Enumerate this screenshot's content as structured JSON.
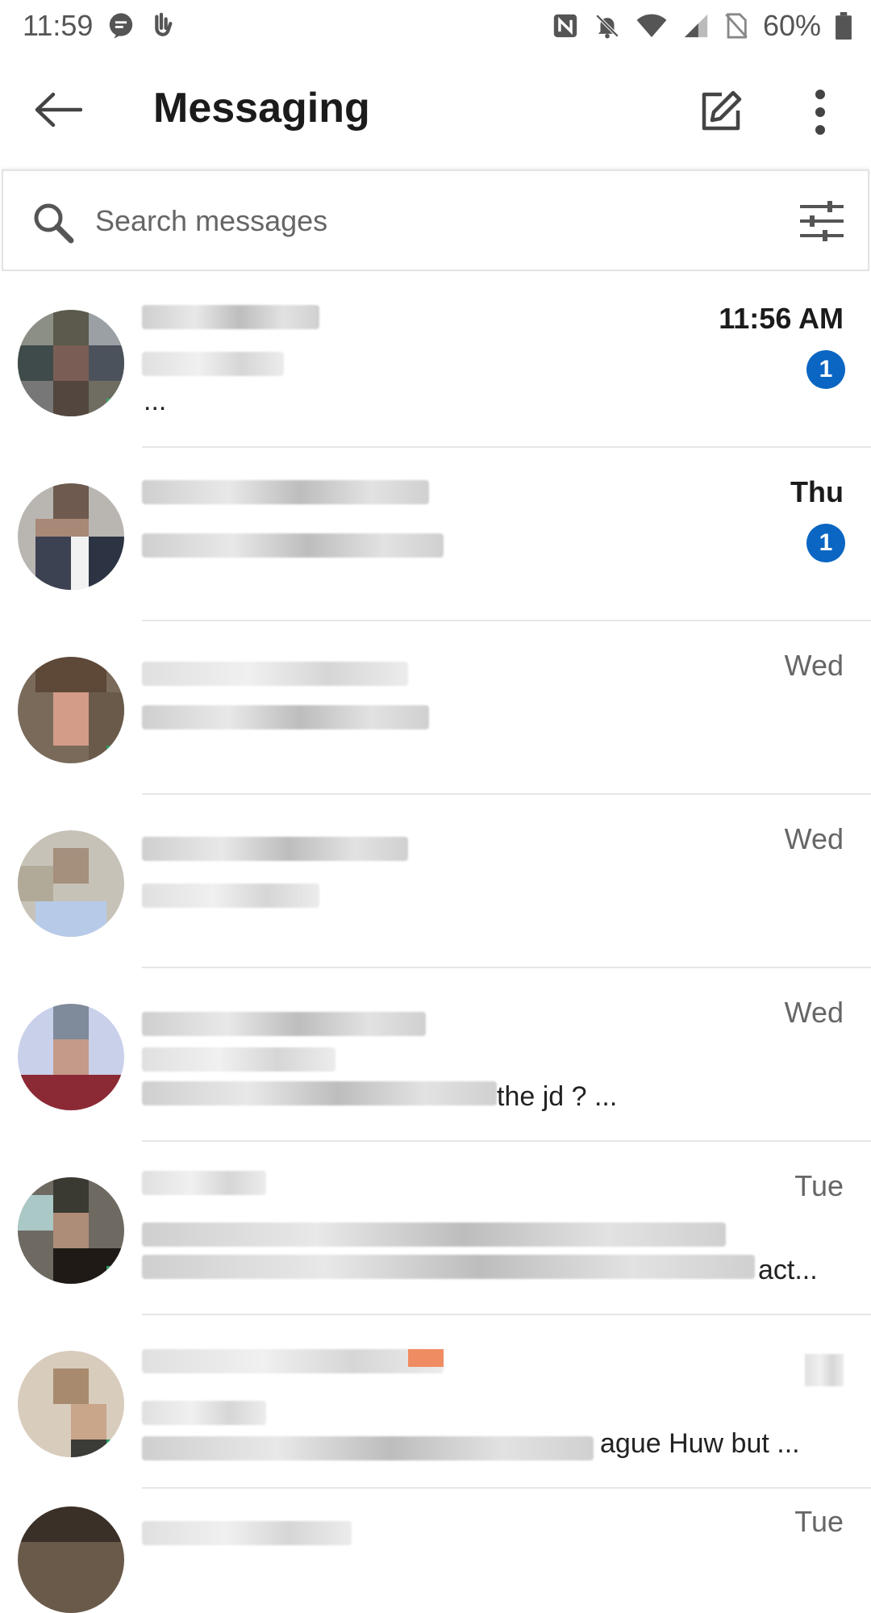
{
  "status_bar": {
    "time": "11:59",
    "battery": "60%",
    "left_icons": [
      "chat-notification-icon",
      "hand-icon"
    ],
    "right_icons": [
      "nfc-icon",
      "bell-off-icon",
      "wifi-icon",
      "cellular-icon",
      "no-sim-icon",
      "battery-icon"
    ]
  },
  "app_bar": {
    "title": "Messaging",
    "back_icon": "arrow-left-icon",
    "compose_icon": "compose-icon",
    "more_icon": "more-vert-icon"
  },
  "search": {
    "placeholder": "Search messages",
    "icon": "search-icon",
    "filter_icon": "filter-icon"
  },
  "conversations": [
    {
      "time": "11:56 AM",
      "time_bold": true,
      "unread": "1",
      "snippet": "..."
    },
    {
      "time": "Thu",
      "time_bold": true,
      "unread": "1",
      "snippet": ""
    },
    {
      "time": "Wed",
      "time_bold": false,
      "unread": "",
      "snippet": ""
    },
    {
      "time": "Wed",
      "time_bold": false,
      "unread": "",
      "snippet": ""
    },
    {
      "time": "Wed",
      "time_bold": false,
      "unread": "",
      "snippet": "the jd ? ..."
    },
    {
      "time": "Tue",
      "time_bold": false,
      "unread": "",
      "snippet": "act..."
    },
    {
      "time": "",
      "time_bold": false,
      "unread": "",
      "snippet": "ague Huw but ..."
    },
    {
      "time": "Tue",
      "time_bold": false,
      "unread": "",
      "snippet": ""
    }
  ],
  "colors": {
    "badge": "#0a66c2",
    "text_primary": "#1b1b1b",
    "text_secondary": "#666666"
  }
}
